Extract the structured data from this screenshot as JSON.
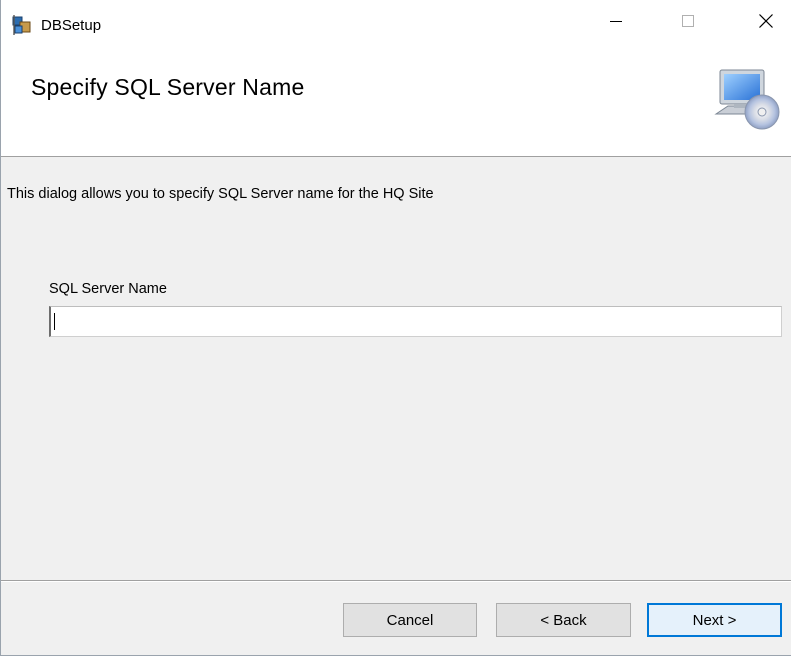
{
  "window": {
    "title": "DBSetup",
    "controls": {
      "minimize": "minimize-icon",
      "maximize": "maximize-icon",
      "close": "close-icon"
    }
  },
  "banner": {
    "title": "Specify SQL Server Name",
    "icon": "computer-disc-icon"
  },
  "main": {
    "description": "This dialog allows you to specify SQL Server name for the HQ Site",
    "sql_server_label": "SQL Server Name",
    "sql_server_value": ""
  },
  "footer": {
    "cancel_label": "Cancel",
    "back_label": "< Back",
    "next_label": "Next >"
  },
  "colors": {
    "window_background": "#f0f0f0",
    "banner_background": "#ffffff",
    "focus_accent": "#0078d7"
  }
}
